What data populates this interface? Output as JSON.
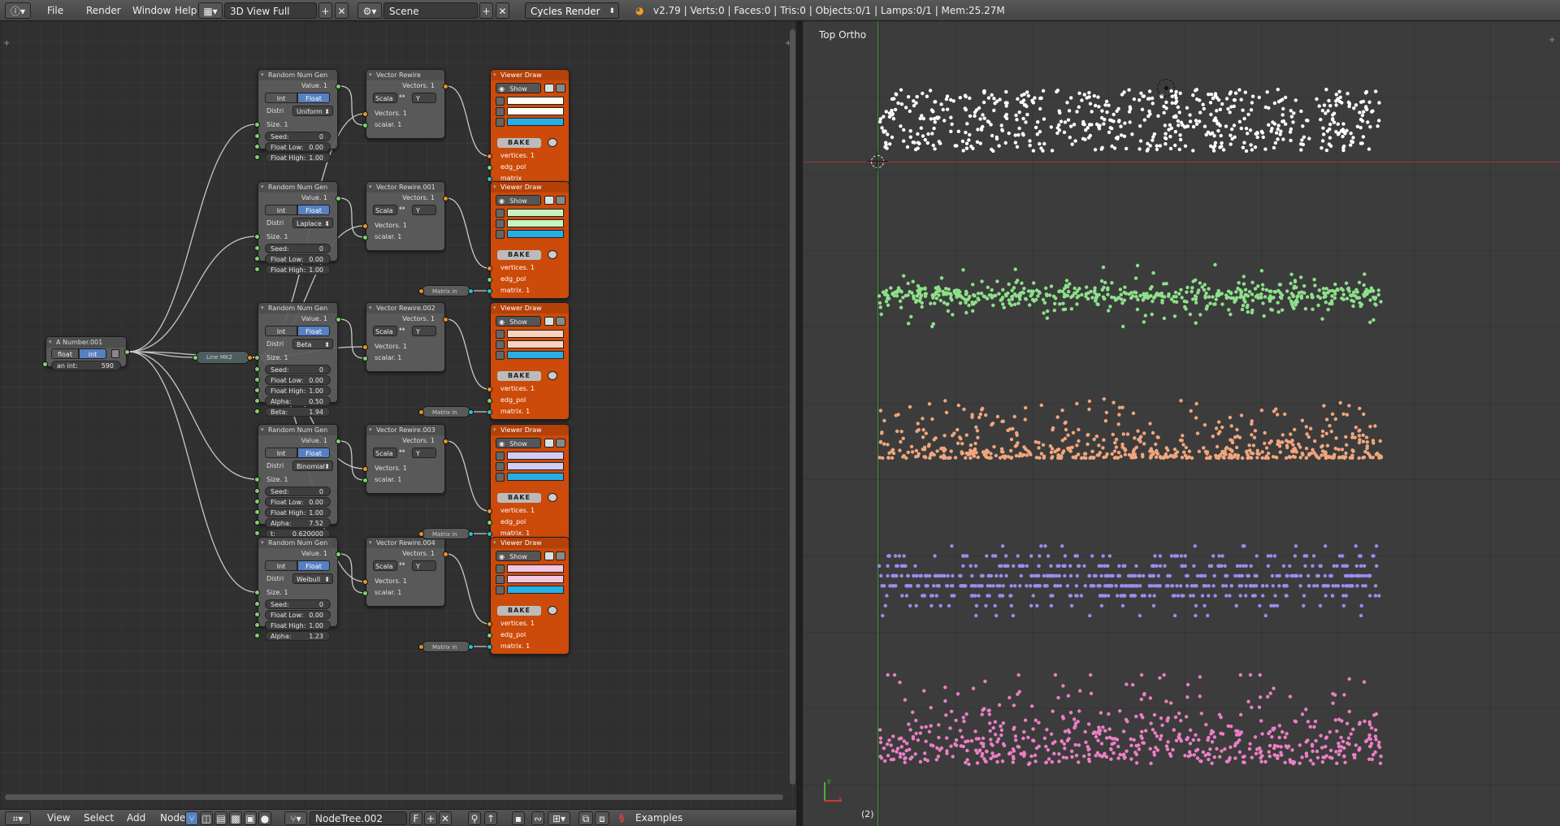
{
  "topbar": {
    "info_icon": "info-icon",
    "menus": [
      "File",
      "Render",
      "Window",
      "Help"
    ],
    "screen_layout": "3D View Full",
    "scene": "Scene",
    "engine": "Cycles Render",
    "stats": "v2.79 | Verts:0 | Faces:0 | Tris:0 | Objects:0/1 | Lamps:0/1 | Mem:25.27M"
  },
  "viewport": {
    "label": "Top Ortho",
    "frame": "(2)"
  },
  "bottombar": {
    "menus": [
      "View",
      "Select",
      "Add",
      "Node"
    ],
    "tree_name": "NodeTree.002",
    "fake_user": "F",
    "examples": "Examples"
  },
  "number_node": {
    "title": "A Number.001",
    "mode_a": "float",
    "mode_b": "int",
    "field_label": "an int:",
    "field_value": "590"
  },
  "line_node": {
    "title": "Line MK2"
  },
  "random_nodes": [
    {
      "title": "Random Num Gen",
      "value_out": "Value. 1",
      "seg_a": "Int",
      "seg_b": "Float",
      "distr_label": "Distri",
      "distr": "Uniform",
      "size": "Size. 1",
      "fields": [
        {
          "label": "Seed:",
          "value": "0"
        },
        {
          "label": "Float Low:",
          "value": "0.00"
        },
        {
          "label": "Float High:",
          "value": "1.00"
        }
      ]
    },
    {
      "title": "Random Num Gen",
      "value_out": "Value. 1",
      "seg_a": "Int",
      "seg_b": "Float",
      "distr_label": "Distri",
      "distr": "Laplace",
      "size": "Size. 1",
      "fields": [
        {
          "label": "Seed:",
          "value": "0"
        },
        {
          "label": "Float Low:",
          "value": "0.00"
        },
        {
          "label": "Float High:",
          "value": "1.00"
        }
      ]
    },
    {
      "title": "Random Num Gen",
      "value_out": "Value. 1",
      "seg_a": "Int",
      "seg_b": "Float",
      "distr_label": "Distri",
      "distr": "Beta",
      "size": "Size. 1",
      "fields": [
        {
          "label": "Seed:",
          "value": "0"
        },
        {
          "label": "Float Low:",
          "value": "0.00"
        },
        {
          "label": "Float High:",
          "value": "1.00"
        },
        {
          "label": "Alpha:",
          "value": "0.50"
        },
        {
          "label": "Beta:",
          "value": "1.94"
        }
      ]
    },
    {
      "title": "Random Num Gen",
      "value_out": "Value. 1",
      "seg_a": "Int",
      "seg_b": "Float",
      "distr_label": "Distri",
      "distr": "Binomial",
      "size": "Size. 1",
      "fields": [
        {
          "label": "Seed:",
          "value": "0"
        },
        {
          "label": "Float Low:",
          "value": "0.00"
        },
        {
          "label": "Float High:",
          "value": "1.00"
        },
        {
          "label": "Alpha:",
          "value": "7.52"
        },
        {
          "label": "t:",
          "value": "0.620000"
        }
      ]
    },
    {
      "title": "Random Num Gen",
      "value_out": "Value. 1",
      "seg_a": "Int",
      "seg_b": "Float",
      "distr_label": "Distri",
      "distr": "Weibull",
      "size": "Size. 1",
      "fields": [
        {
          "label": "Seed:",
          "value": "0"
        },
        {
          "label": "Float Low:",
          "value": "0.00"
        },
        {
          "label": "Float High:",
          "value": "1.00"
        },
        {
          "label": "Alpha:",
          "value": "1.23"
        }
      ]
    }
  ],
  "rewire_nodes": [
    {
      "title": "Vector Rewire",
      "out": "Vectors. 1",
      "from": "Scala",
      "to": "Y",
      "in_a": "Vectors. 1",
      "in_b": "scalar. 1"
    },
    {
      "title": "Vector Rewire.001",
      "out": "Vectors. 1",
      "from": "Scala",
      "to": "Y",
      "in_a": "Vectors. 1",
      "in_b": "scalar. 1"
    },
    {
      "title": "Vector Rewire.002",
      "out": "Vectors. 1",
      "from": "Scala",
      "to": "Y",
      "in_a": "Vectors. 1",
      "in_b": "scalar. 1"
    },
    {
      "title": "Vector Rewire.003",
      "out": "Vectors. 1",
      "from": "Scala",
      "to": "Y",
      "in_a": "Vectors. 1",
      "in_b": "scalar. 1"
    },
    {
      "title": "Vector Rewire.004",
      "out": "Vectors. 1",
      "from": "Scala",
      "to": "Y",
      "in_a": "Vectors. 1",
      "in_b": "scalar. 1"
    }
  ],
  "viewer_nodes": [
    {
      "title": "Viewer Draw",
      "show": "Show",
      "bake": "BAKE",
      "in_v": "vertices. 1",
      "in_e": "edg_pol",
      "in_m": "matrix",
      "color": "#fdfdf6"
    },
    {
      "title": "Viewer Draw",
      "show": "Show",
      "bake": "BAKE",
      "in_v": "vertices. 1",
      "in_e": "edg_pol",
      "in_m": "matrix. 1",
      "color": "#c6f5c0"
    },
    {
      "title": "Viewer Draw",
      "show": "Show",
      "bake": "BAKE",
      "in_v": "vertices. 1",
      "in_e": "edg_pol",
      "in_m": "matrix. 1",
      "color": "#f8d2bd"
    },
    {
      "title": "Viewer Draw",
      "show": "Show",
      "bake": "BAKE",
      "in_v": "vertices. 1",
      "in_e": "edg_pol",
      "in_m": "matrix. 1",
      "color": "#d2ccf5"
    },
    {
      "title": "Viewer Draw",
      "show": "Show",
      "bake": "BAKE",
      "in_v": "vertices. 1",
      "in_e": "edg_pol",
      "in_m": "matrix. 1",
      "color": "#f4c6e2"
    }
  ],
  "matrix_nodes": [
    {
      "title": "Matrix in"
    },
    {
      "title": "Matrix in"
    },
    {
      "title": "Matrix in"
    },
    {
      "title": "Matrix in"
    }
  ],
  "point_clouds": [
    {
      "distribution": "Uniform",
      "color": "#ffffff"
    },
    {
      "distribution": "Laplace",
      "color": "#8ee08a"
    },
    {
      "distribution": "Beta",
      "color": "#f0a67c"
    },
    {
      "distribution": "Binomial",
      "color": "#9a8cf0"
    },
    {
      "distribution": "Weibull",
      "color": "#ec7fc5"
    }
  ]
}
